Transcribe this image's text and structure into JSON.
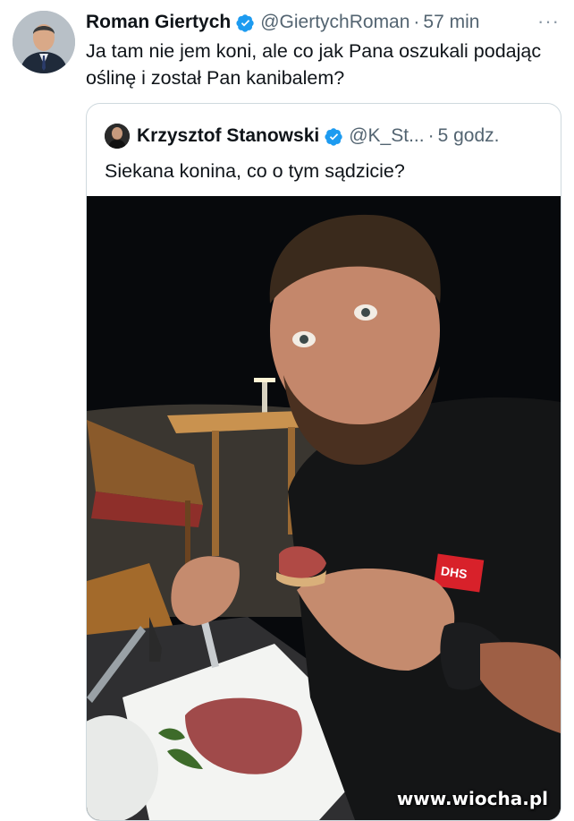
{
  "tweet": {
    "author_name": "Roman Giertych",
    "author_handle": "@GiertychRoman",
    "separator": "·",
    "time": "57 min",
    "more": "···",
    "text": "Ja tam nie jem koni, ale co jak Pana oszukali podając oślinę i został Pan kanibalem?"
  },
  "quoted_tweet": {
    "author_name": "Krzysztof Stanowski",
    "author_handle": "@K_St...",
    "separator": "·",
    "time": "5 godz.",
    "text": "Siekana konina, co o tym sądzicie?",
    "photo_shirt_logo": "DHS"
  },
  "watermark": "www.wiocha.pl",
  "colors": {
    "verified": "#1d9bf0",
    "secondary_text": "#536471",
    "border": "#cfd9de"
  },
  "icons": [
    "verified-badge-icon",
    "more-options-icon"
  ]
}
